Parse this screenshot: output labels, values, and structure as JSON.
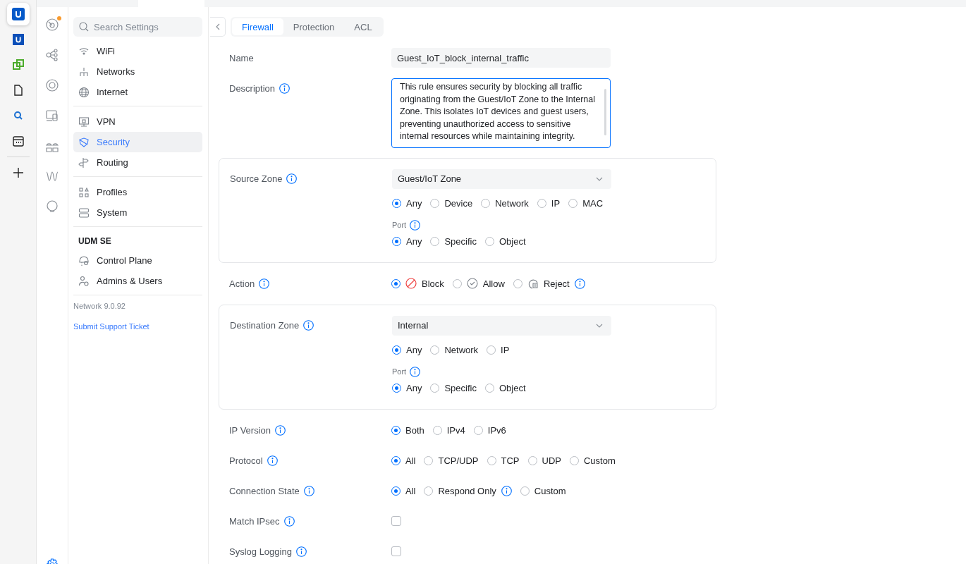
{
  "app_rail": [
    {
      "kind": "u-logo",
      "selected": true
    },
    {
      "kind": "u-square",
      "selected": false
    },
    {
      "kind": "puzzle",
      "selected": false
    },
    {
      "kind": "file",
      "selected": false
    },
    {
      "kind": "search",
      "selected": false
    },
    {
      "kind": "calendar",
      "selected": false
    },
    {
      "kind": "add",
      "selected": false
    }
  ],
  "nav_rail": [
    {
      "kind": "dashboard",
      "badge": true,
      "selected": false
    },
    {
      "kind": "topology",
      "badge": false,
      "selected": false
    },
    {
      "kind": "devices",
      "badge": false,
      "selected": false
    },
    {
      "kind": "clients",
      "badge": false,
      "selected": false
    },
    {
      "kind": "apps",
      "badge": false,
      "selected": false
    },
    {
      "kind": "insights",
      "badge": false,
      "selected": false
    },
    {
      "kind": "bulb",
      "badge": false,
      "selected": false
    },
    {
      "kind": "settings",
      "badge": false,
      "selected": true
    }
  ],
  "settings_nav": {
    "search": {
      "placeholder": "Search Settings"
    },
    "groups": [
      {
        "items": [
          {
            "label": "WiFi",
            "selected": false
          },
          {
            "label": "Networks",
            "selected": false
          },
          {
            "label": "Internet",
            "selected": false
          }
        ]
      },
      {
        "items": [
          {
            "label": "VPN",
            "selected": false
          },
          {
            "label": "Security",
            "selected": true
          },
          {
            "label": "Routing",
            "selected": false
          }
        ]
      },
      {
        "items": [
          {
            "label": "Profiles",
            "selected": false
          },
          {
            "label": "System",
            "selected": false
          }
        ]
      },
      {
        "heading": "UDM SE",
        "items": [
          {
            "label": "Control Plane",
            "selected": false
          },
          {
            "label": "Admins & Users",
            "selected": false
          }
        ]
      }
    ],
    "version": "Network 9.0.92",
    "support_link": "Submit Support Ticket"
  },
  "tabs": [
    {
      "label": "Firewall",
      "selected": true
    },
    {
      "label": "Protection",
      "selected": false
    },
    {
      "label": "ACL",
      "selected": false
    }
  ],
  "form": [
    {
      "kind": "text",
      "label": "Name",
      "info": false,
      "value": "Guest_IoT_block_internal_traffic"
    },
    {
      "kind": "textarea",
      "label": "Description",
      "info": true,
      "value": "This rule ensures security by blocking all traffic originating from the Guest/IoT Zone to the Internal Zone. This isolates IoT devices and guest users, preventing unauthorized access to sensitive internal resources while maintaining integrity."
    },
    {
      "kind": "zone",
      "label": "Source Zone",
      "info": true,
      "select": {
        "value": "Guest/IoT Zone"
      },
      "options": [
        {
          "label": "Any",
          "selected": true
        },
        {
          "label": "Device",
          "selected": false
        },
        {
          "label": "Network",
          "selected": false
        },
        {
          "label": "IP",
          "selected": false
        },
        {
          "label": "MAC",
          "selected": false
        }
      ],
      "port": {
        "label": "Port",
        "info": true,
        "options": [
          {
            "label": "Any",
            "selected": true
          },
          {
            "label": "Specific",
            "selected": false
          },
          {
            "label": "Object",
            "selected": false
          }
        ]
      }
    },
    {
      "kind": "radio",
      "label": "Action",
      "info": true,
      "options": [
        {
          "label": "Block",
          "selected": true,
          "kind": "block"
        },
        {
          "label": "Allow",
          "selected": false,
          "kind": "allow"
        },
        {
          "label": "Reject",
          "selected": false,
          "kind": "reject",
          "info": true
        }
      ]
    },
    {
      "kind": "zone",
      "label": "Destination Zone",
      "info": true,
      "select": {
        "value": "Internal"
      },
      "options": [
        {
          "label": "Any",
          "selected": true
        },
        {
          "label": "Network",
          "selected": false
        },
        {
          "label": "IP",
          "selected": false
        }
      ],
      "port": {
        "label": "Port",
        "info": true,
        "options": [
          {
            "label": "Any",
            "selected": true
          },
          {
            "label": "Specific",
            "selected": false
          },
          {
            "label": "Object",
            "selected": false
          }
        ]
      }
    },
    {
      "kind": "radio",
      "label": "IP Version",
      "info": true,
      "options": [
        {
          "label": "Both",
          "selected": true
        },
        {
          "label": "IPv4",
          "selected": false
        },
        {
          "label": "IPv6",
          "selected": false
        }
      ]
    },
    {
      "kind": "radio",
      "label": "Protocol",
      "info": true,
      "options": [
        {
          "label": "All",
          "selected": true
        },
        {
          "label": "TCP/UDP",
          "selected": false
        },
        {
          "label": "TCP",
          "selected": false
        },
        {
          "label": "UDP",
          "selected": false
        },
        {
          "label": "Custom",
          "selected": false
        }
      ]
    },
    {
      "kind": "radio",
      "label": "Connection State",
      "info": true,
      "options": [
        {
          "label": "All",
          "selected": true
        },
        {
          "label": "Respond Only",
          "selected": false,
          "info": true
        },
        {
          "label": "Custom",
          "selected": false
        }
      ]
    },
    {
      "kind": "checkbox",
      "label": "Match IPsec",
      "info": true,
      "checked": false
    },
    {
      "kind": "checkbox",
      "label": "Syslog Logging",
      "info": true,
      "checked": false
    }
  ]
}
